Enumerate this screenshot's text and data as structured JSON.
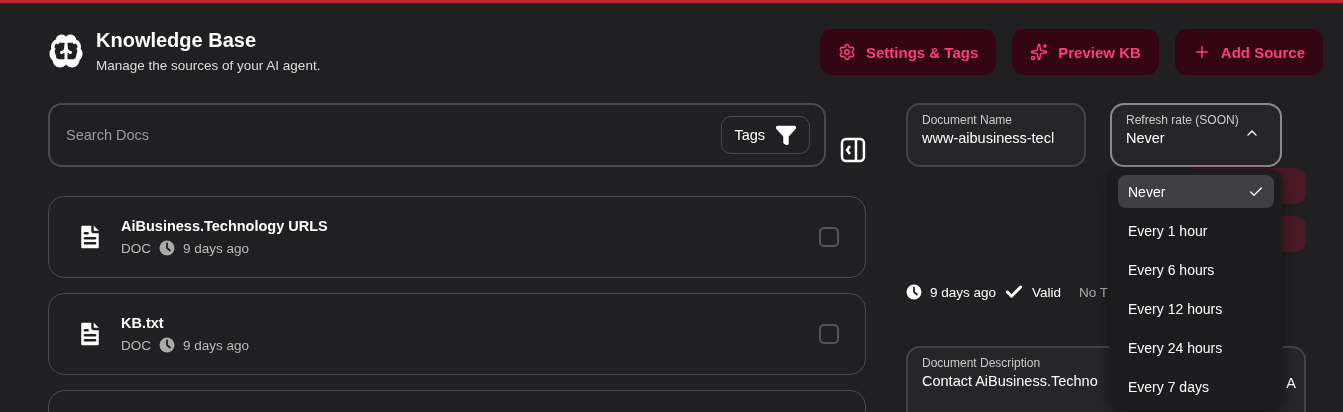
{
  "header": {
    "title": "Knowledge Base",
    "subtitle": "Manage the sources of your AI agent."
  },
  "actions": [
    {
      "label": "Settings & Tags"
    },
    {
      "label": "Preview KB"
    },
    {
      "label": "Add Source"
    }
  ],
  "search": {
    "placeholder": "Search Docs",
    "tags_button": "Tags"
  },
  "documents": [
    {
      "kind": "document",
      "name": "AiBusiness.Technology URLS",
      "type": "DOC",
      "age": "9 days ago",
      "checked": false
    },
    {
      "kind": "document",
      "name": "KB.txt",
      "type": "DOC",
      "age": "9 days ago",
      "checked": false
    },
    {
      "kind": "cut"
    }
  ],
  "detail": {
    "name_label": "Document Name",
    "name_value": "www-aibusiness-tecl",
    "refresh_label": "Refresh rate (SOON)",
    "refresh_value": "Never",
    "expanded": true,
    "options": [
      {
        "label": "Never",
        "selected": true
      },
      {
        "label": "Every 1 hour",
        "selected": false
      },
      {
        "label": "Every 6 hours",
        "selected": false
      },
      {
        "label": "Every 12 hours",
        "selected": false
      },
      {
        "label": "Every 24 hours",
        "selected": false
      },
      {
        "label": "Every 7 days",
        "selected": false
      }
    ],
    "age": "9 days ago",
    "status": "Valid",
    "tags": "No T",
    "description_label": "Document Description",
    "description_value": "Contact AiBusiness.Techno",
    "description_tail": "A"
  }
}
